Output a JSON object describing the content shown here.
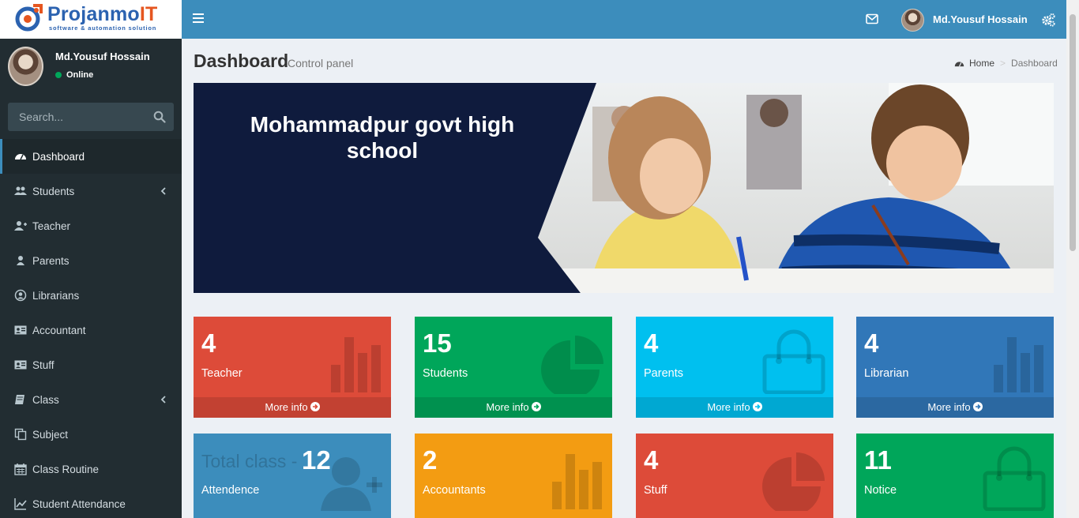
{
  "brand": {
    "name_main": "Projanmo",
    "name_accent": "IT",
    "tagline": "software & automation solution"
  },
  "user": {
    "name": "Md.Yousuf Hossain",
    "status": "Online"
  },
  "search": {
    "placeholder": "Search..."
  },
  "menu": [
    {
      "label": "Dashboard",
      "icon": "dashboard-icon",
      "active": true
    },
    {
      "label": "Students",
      "icon": "users-icon",
      "has_submenu": true
    },
    {
      "label": "Teacher",
      "icon": "user-plus-icon"
    },
    {
      "label": "Parents",
      "icon": "user-icon"
    },
    {
      "label": "Librarians",
      "icon": "user-circle-icon"
    },
    {
      "label": "Accountant",
      "icon": "id-card-icon"
    },
    {
      "label": "Stuff",
      "icon": "id-card-icon"
    },
    {
      "label": "Class",
      "icon": "book-icon",
      "has_submenu": true
    },
    {
      "label": "Subject",
      "icon": "copy-icon"
    },
    {
      "label": "Class Routine",
      "icon": "calendar-icon"
    },
    {
      "label": "Student Attendance",
      "icon": "line-chart-icon"
    }
  ],
  "header": {
    "user_name": "Md.Yousuf Hossain"
  },
  "page": {
    "title": "Dashboard",
    "subtitle": "Control panel"
  },
  "breadcrumb": {
    "home": "Home",
    "current": "Dashboard"
  },
  "banner": {
    "title": "Mohammadpur govt high school"
  },
  "stats": [
    {
      "value": "4",
      "label": "Teacher",
      "footer": "More info",
      "color": "#dd4b39",
      "icon": "bar-chart-icon"
    },
    {
      "value": "15",
      "label": "Students",
      "footer": "More info",
      "color": "#00a65a",
      "icon": "pie-chart-icon"
    },
    {
      "value": "4",
      "label": "Parents",
      "footer": "More info",
      "color": "#00c0ef",
      "icon": "shopping-bag-icon"
    },
    {
      "value": "4",
      "label": "Librarian",
      "footer": "More info",
      "color": "#3177b8",
      "icon": "bar-chart-icon"
    },
    {
      "value": "12",
      "prefix": "Total class -",
      "label": "Attendence",
      "color": "#3c8dbc",
      "icon": "user-add-icon"
    },
    {
      "value": "2",
      "label": "Accountants",
      "color": "#f39c12",
      "icon": "bar-chart-icon"
    },
    {
      "value": "4",
      "label": "Stuff",
      "color": "#dd4b39",
      "icon": "pie-chart-icon"
    },
    {
      "value": "11",
      "label": "Notice",
      "color": "#00a65a",
      "icon": "shopping-bag-icon"
    }
  ]
}
